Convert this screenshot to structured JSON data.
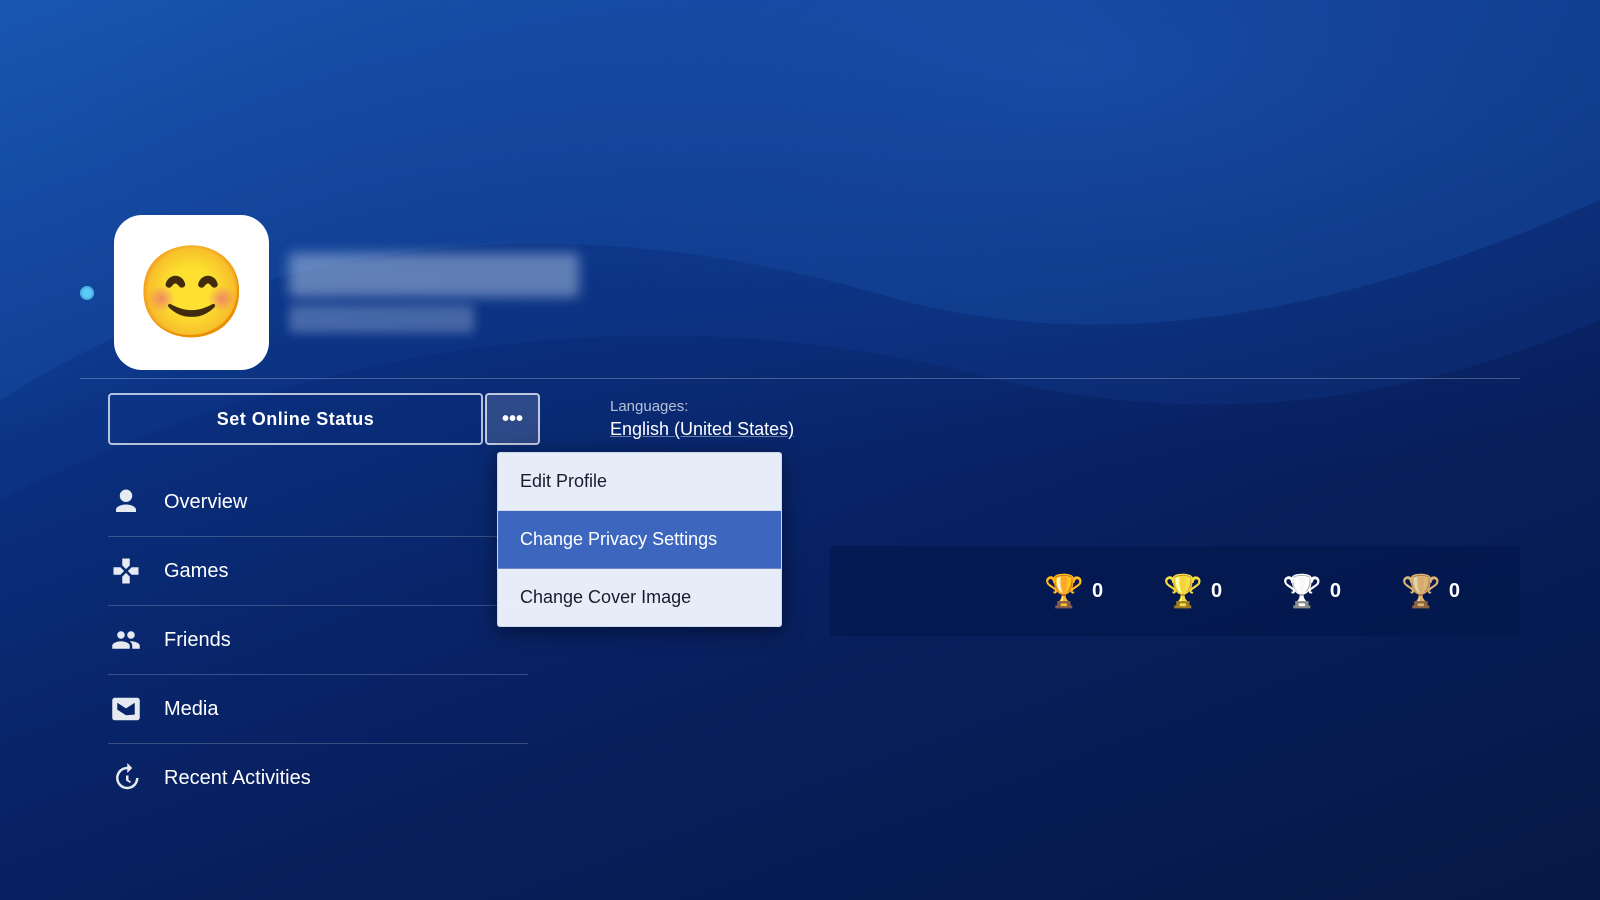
{
  "background": {
    "color_start": "#1a5cb8",
    "color_end": "#061845"
  },
  "user": {
    "online_status": "online",
    "avatar_emoji": "😊"
  },
  "buttons": {
    "set_online_status": "Set Online Status",
    "more_dots": "•••"
  },
  "languages": {
    "label": "Languages:",
    "value": "English (United States)"
  },
  "nav": {
    "items": [
      {
        "id": "overview",
        "label": "Overview"
      },
      {
        "id": "games",
        "label": "Games"
      },
      {
        "id": "friends",
        "label": "Friends"
      },
      {
        "id": "media",
        "label": "Media"
      },
      {
        "id": "recent-activities",
        "label": "Recent Activities"
      }
    ]
  },
  "trophies": {
    "platinum": {
      "count": "0"
    },
    "gold": {
      "count": "0"
    },
    "silver": {
      "count": "0"
    },
    "bronze": {
      "count": "0"
    }
  },
  "dropdown": {
    "items": [
      {
        "id": "edit-profile",
        "label": "Edit Profile",
        "active": false
      },
      {
        "id": "change-privacy-settings",
        "label": "Change Privacy Settings",
        "active": true
      },
      {
        "id": "change-cover-image",
        "label": "Change Cover Image",
        "active": false
      }
    ]
  }
}
